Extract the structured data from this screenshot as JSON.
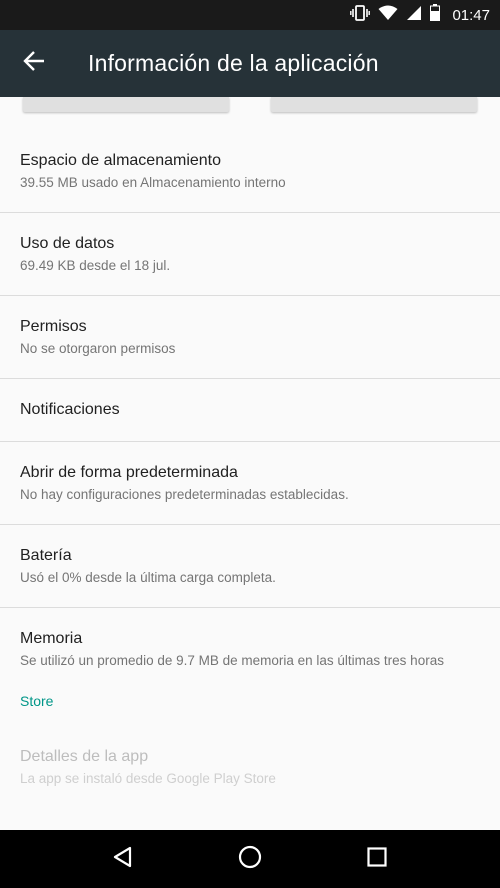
{
  "status_bar": {
    "time": "01:47",
    "icons": [
      "vibrate-icon",
      "wifi-icon",
      "signal-icon",
      "battery-icon"
    ]
  },
  "app_bar": {
    "back_icon": "arrow-back-icon",
    "title": "Información de la aplicación",
    "background": "#263238"
  },
  "preferences": [
    {
      "title": "Espacio de almacenamiento",
      "summary": "39.55 MB usado en Almacenamiento interno"
    },
    {
      "title": "Uso de datos",
      "summary": "69.49 KB desde el 18 jul."
    },
    {
      "title": "Permisos",
      "summary": "No se otorgaron permisos"
    },
    {
      "title": "Notificaciones",
      "summary": ""
    },
    {
      "title": "Abrir de forma predeterminada",
      "summary": "No hay configuraciones predeterminadas establecidas."
    },
    {
      "title": "Batería",
      "summary": "Usó el 0% desde la última carga completa."
    },
    {
      "title": "Memoria",
      "summary": "Se utilizó un promedio de 9.7 MB de memoria en las últimas tres horas"
    }
  ],
  "store": {
    "category": "Store",
    "accent": "#009688",
    "title": "Detalles de la app",
    "summary": "La app se instaló desde Google Play Store"
  },
  "nav_bar": {
    "icons": [
      "back-triangle-icon",
      "home-circle-icon",
      "recents-square-icon"
    ]
  }
}
